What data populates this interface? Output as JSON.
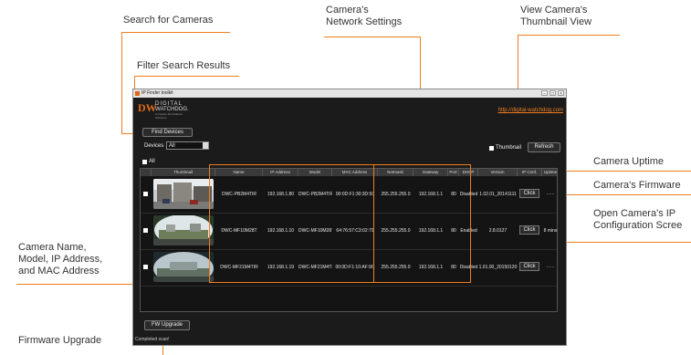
{
  "annotations": {
    "search_cameras": "Search for Cameras",
    "filter_results": "Filter Search Results",
    "network_settings_line1": "Camera's",
    "network_settings_line2": "Network Settings",
    "thumbnail_view_line1": "View Camera's",
    "thumbnail_view_line2": "Thumbnail View",
    "camera_uptime": "Camera Uptime",
    "camera_firmware": "Camera's Firmware",
    "ip_config_line1": "Open Camera's IP",
    "ip_config_line2": "Configuration Scree",
    "camera_name_line1": "Camera Name,",
    "camera_name_line2": "Model, IP Address,",
    "camera_name_line3": "and MAC Address",
    "firmware_upgrade": "Firmware Upgrade"
  },
  "app": {
    "title": "IP Finder toolkit",
    "logo_mark": "DW",
    "logo_line1": "DIGITAL",
    "logo_line2": "WATCHDOG.",
    "logo_tagline": "Complete Surveillance Solutions",
    "site_link": "http://digital-watchdog.com",
    "find_devices": "Find Devices",
    "devices_label": "Devices",
    "devices_value": "All",
    "thumbnail_label": "Thumbnail",
    "refresh": "Refresh",
    "all_label": "All",
    "fw_upgrade": "FW Upgrade",
    "status": "Completed scan!"
  },
  "table": {
    "columns": [
      "Thumbnail",
      "Name",
      "IP Address",
      "Model",
      "MAC Address",
      "Netmask",
      "Gateway",
      "Port",
      "DHCP",
      "Version",
      "IP Conf.",
      "Uptime"
    ],
    "rows": [
      {
        "name": "DWC-PB2M4TIR",
        "ip": "192.168.1.80",
        "model": "DWC-PB2M4TIR",
        "mac": "00:0D:F1:30:3D:50",
        "netmask": "255.255.255.0",
        "gateway": "192.168.1.1",
        "port": "80",
        "dhcp": "Disabled",
        "version": "1.02.01_20141111",
        "ipconf": "Click",
        "uptime": "- - -"
      },
      {
        "name": "DWC-MF10M28T",
        "ip": "192.168.1.10",
        "model": "DWC-MF10M28T",
        "mac": "64:76:57:C3:02:70",
        "netmask": "255.255.255.0",
        "gateway": "192.168.1.1",
        "port": "80",
        "dhcp": "Enabled",
        "version": "2.8.0127",
        "ipconf": "Click",
        "uptime": "8 mins"
      },
      {
        "name": "DWC-MF21M4TIR",
        "ip": "192.168.1.19",
        "model": "DWC-MF21M4TIR",
        "mac": "00:0D:F1:10:AF:9C",
        "netmask": "255.255.255.0",
        "gateway": "192.168.1.1",
        "port": "80",
        "dhcp": "Disabled",
        "version": "1.01.00_20150120",
        "ipconf": "Click",
        "uptime": "- - -"
      }
    ]
  },
  "colors": {
    "accent": "#f07e1e",
    "window_bg": "#1b1b1b"
  }
}
